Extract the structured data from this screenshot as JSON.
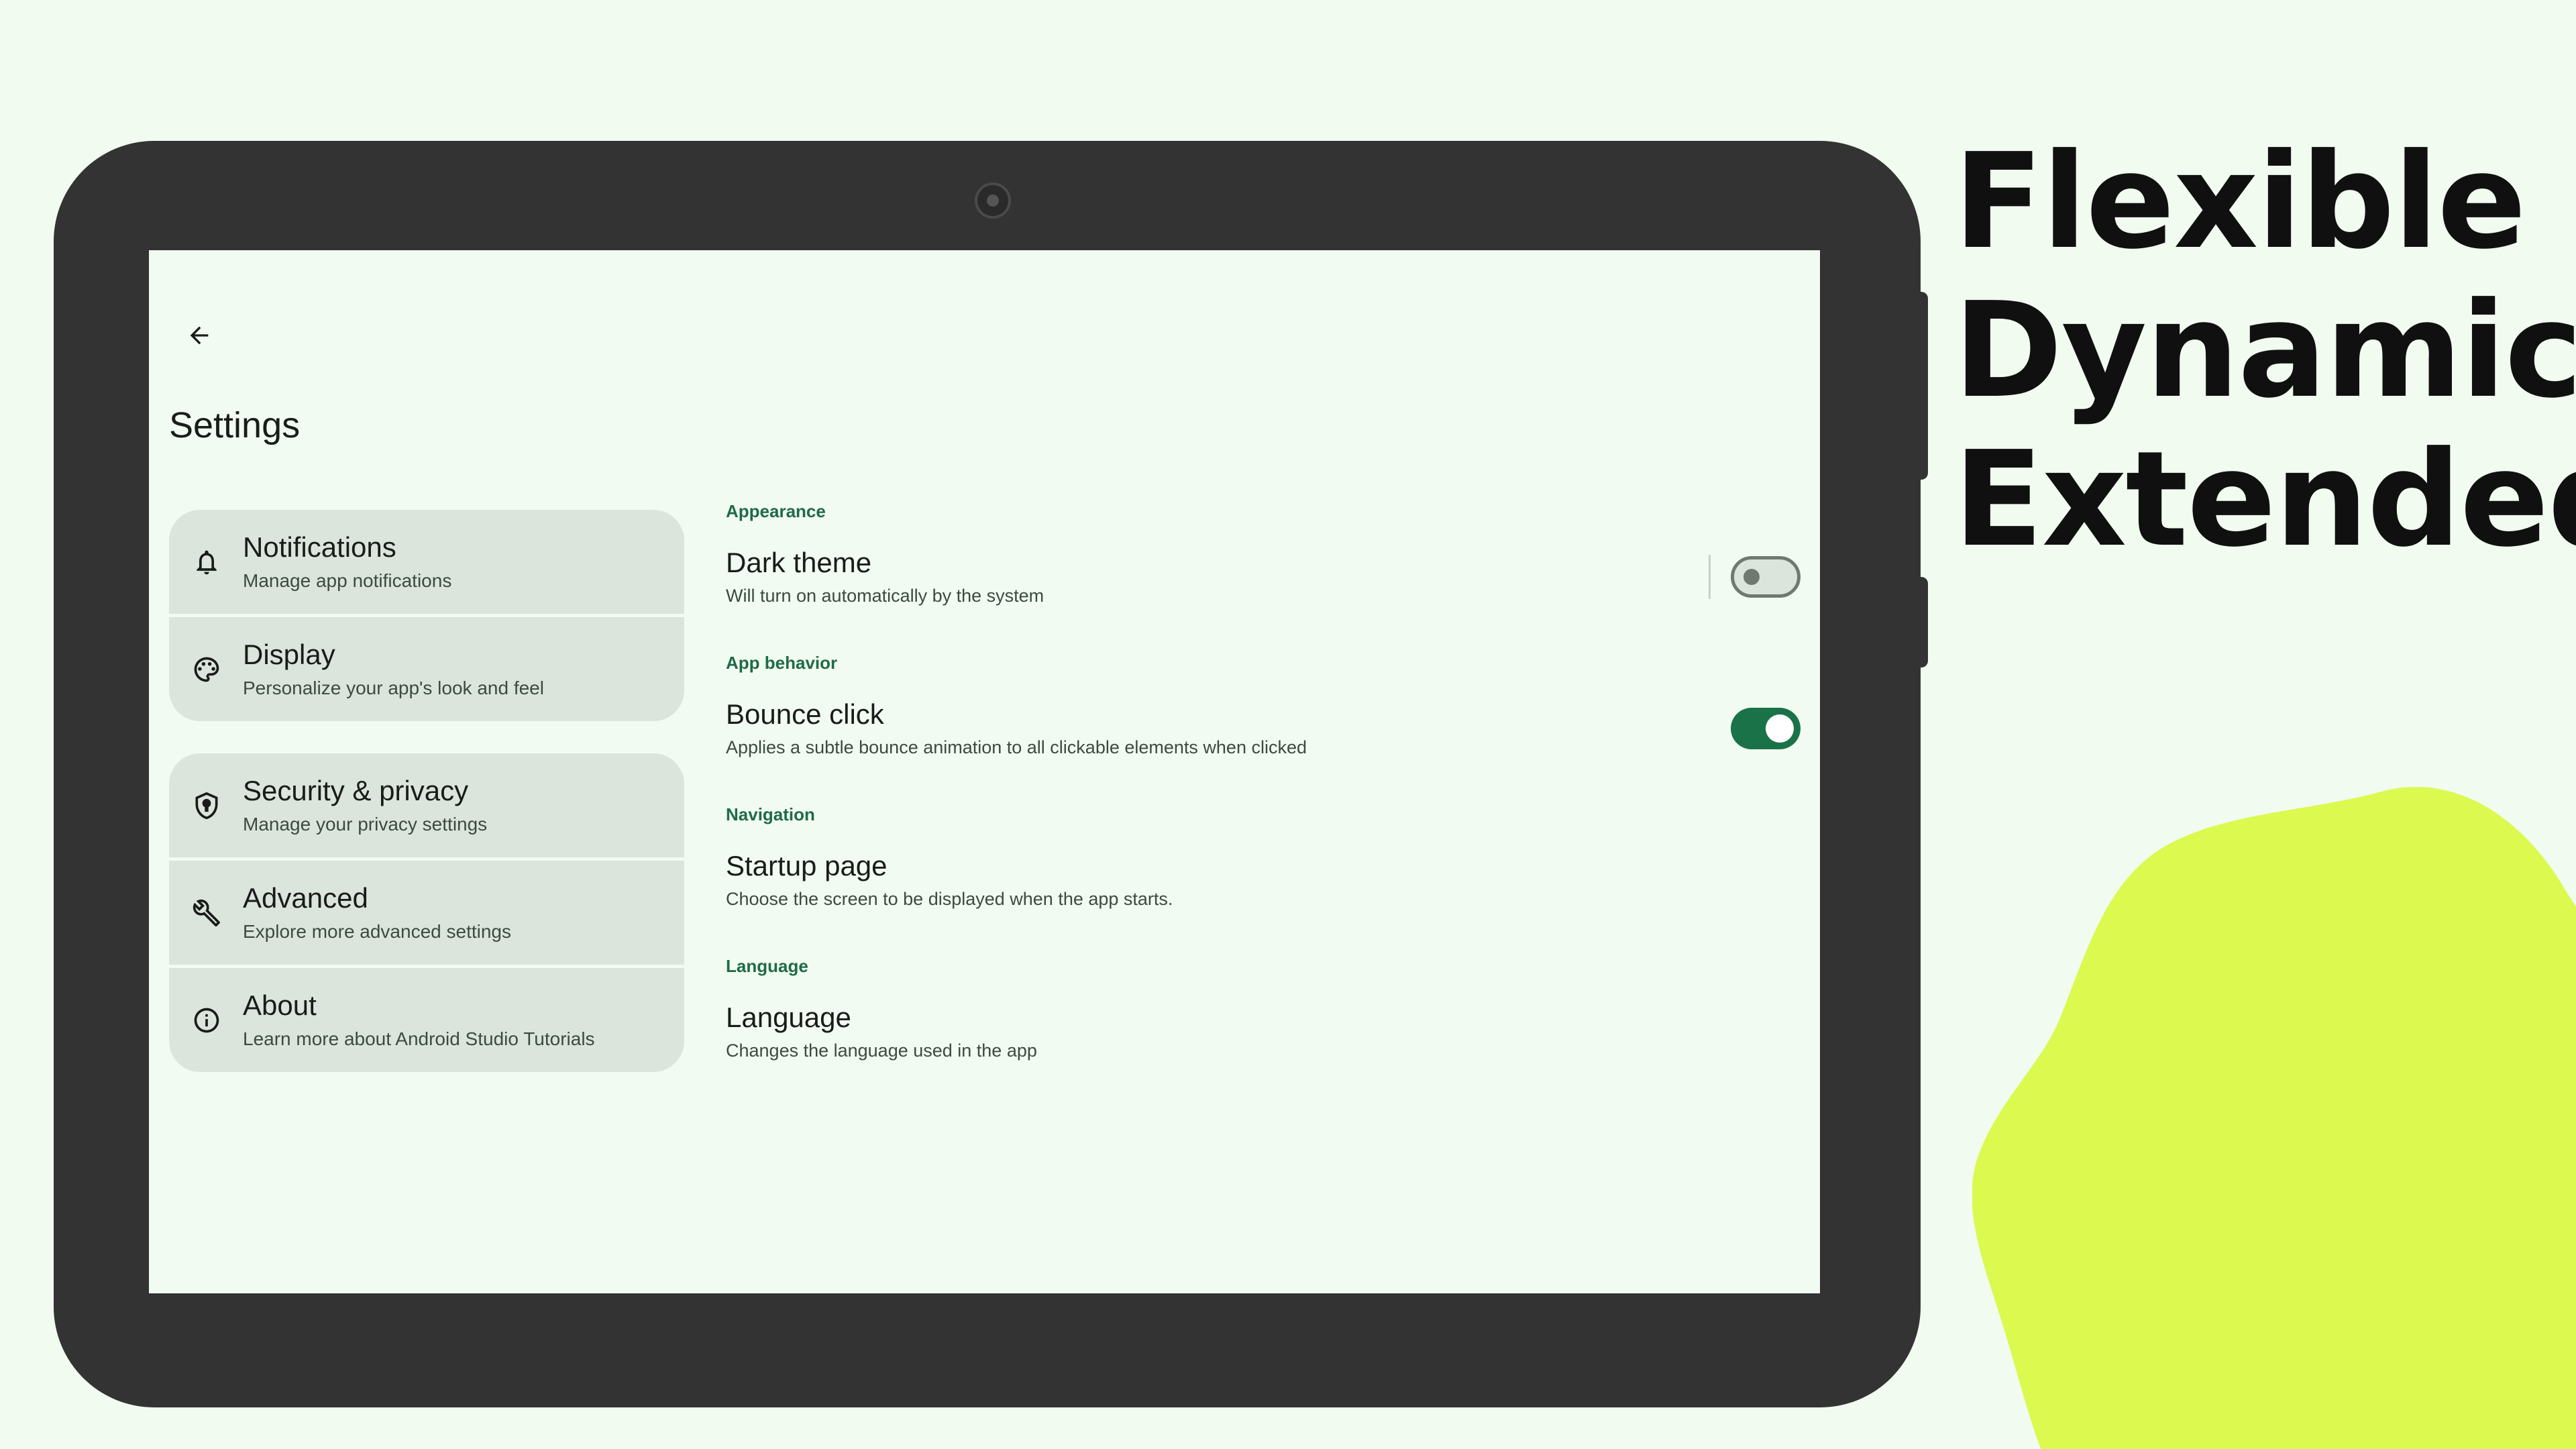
{
  "marketing": {
    "lines": [
      "Flexible",
      "Dynamic",
      "Extended"
    ],
    "blob_color": "#dcf94f"
  },
  "app": {
    "title": "Settings",
    "accent_color": "#1f6b47",
    "back_icon": "arrow-back-icon"
  },
  "menu": {
    "groups": [
      [
        {
          "id": "notifications",
          "icon": "bell-icon",
          "title": "Notifications",
          "subtitle": "Manage app notifications"
        },
        {
          "id": "display",
          "icon": "palette-icon",
          "title": "Display",
          "subtitle": "Personalize your app's look and feel"
        }
      ],
      [
        {
          "id": "security",
          "icon": "shield-icon",
          "title": "Security & privacy",
          "subtitle": "Manage your privacy settings"
        },
        {
          "id": "advanced",
          "icon": "wrench-icon",
          "title": "Advanced",
          "subtitle": "Explore more advanced settings"
        },
        {
          "id": "about",
          "icon": "info-icon",
          "title": "About",
          "subtitle": "Learn more about Android Studio Tutorials"
        }
      ]
    ]
  },
  "prefs": {
    "appearance": {
      "label": "Appearance",
      "dark_theme": {
        "title": "Dark theme",
        "subtitle": "Will turn on automatically by the system",
        "enabled": false
      }
    },
    "behavior": {
      "label": "App behavior",
      "bounce_click": {
        "title": "Bounce click",
        "subtitle": "Applies a subtle bounce animation to all clickable elements when clicked",
        "enabled": true
      }
    },
    "navigation": {
      "label": "Navigation",
      "startup_page": {
        "title": "Startup page",
        "subtitle": "Choose the screen to be displayed when the app starts."
      }
    },
    "language": {
      "label": "Language",
      "language": {
        "title": "Language",
        "subtitle": "Changes the language used in the app"
      }
    }
  }
}
